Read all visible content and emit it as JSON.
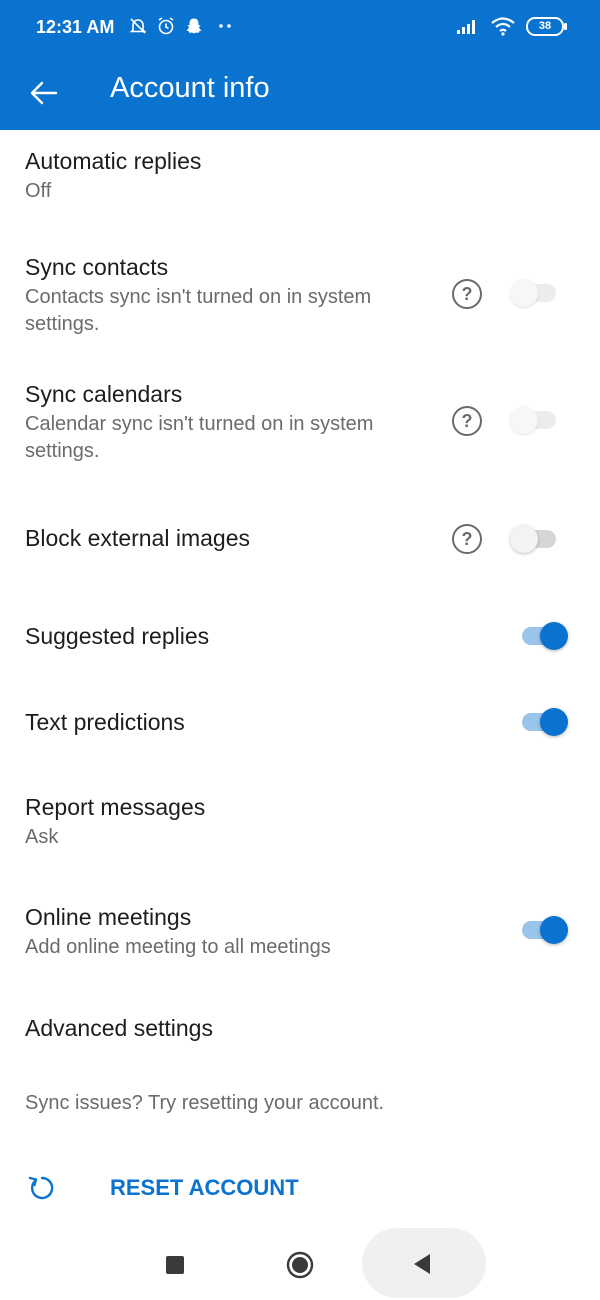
{
  "status_bar": {
    "time": "12:31 AM",
    "left_icons": [
      "muted-bell-icon",
      "alarm-icon",
      "snapchat-icon",
      "more-dots-icon"
    ],
    "battery": "38"
  },
  "app_bar": {
    "title": "Account info"
  },
  "settings": {
    "automatic_replies": {
      "title": "Automatic replies",
      "value": "Off"
    },
    "sync_contacts": {
      "title": "Sync contacts",
      "subtitle": "Contacts sync isn't turned on in system settings.",
      "enabled": false,
      "disabled": true
    },
    "sync_calendars": {
      "title": "Sync calendars",
      "subtitle": "Calendar sync isn't turned on in system settings.",
      "enabled": false,
      "disabled": true
    },
    "block_external_images": {
      "title": "Block external images",
      "enabled": false
    },
    "suggested_replies": {
      "title": "Suggested replies",
      "enabled": true
    },
    "text_predictions": {
      "title": "Text predictions",
      "enabled": true
    },
    "report_messages": {
      "title": "Report messages",
      "value": "Ask"
    },
    "online_meetings": {
      "title": "Online meetings",
      "subtitle": "Add online meeting to all meetings",
      "enabled": true
    },
    "advanced_settings": {
      "title": "Advanced settings"
    }
  },
  "reset": {
    "hint": "Sync issues? Try resetting your account.",
    "label": "RESET ACCOUNT"
  },
  "help_glyph": "?",
  "colors": {
    "accent": "#0a73d0",
    "secondary_text": "#6b6b6b"
  }
}
